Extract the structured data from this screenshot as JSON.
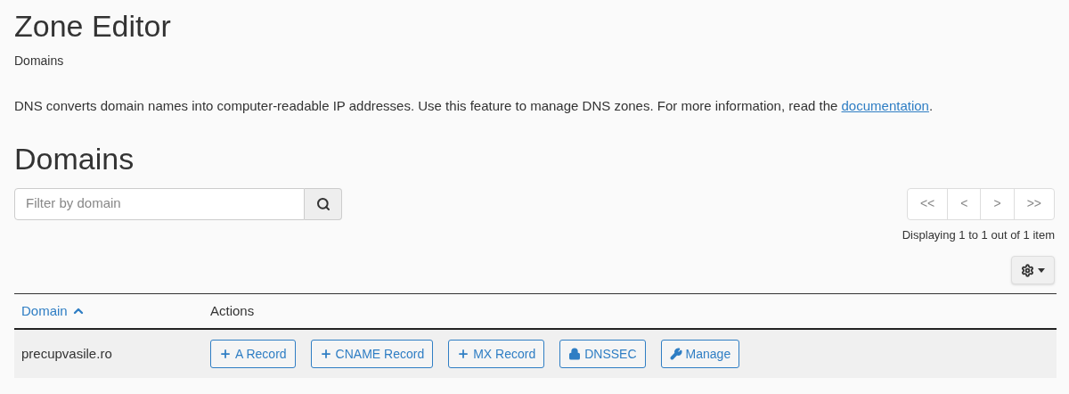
{
  "page": {
    "title": "Zone Editor",
    "breadcrumb": "Domains"
  },
  "intro": {
    "text": "DNS converts domain names into computer-readable IP addresses. Use this feature to manage DNS zones. For more information, read the ",
    "link": "documentation",
    "after": "."
  },
  "section": {
    "title": "Domains"
  },
  "search": {
    "placeholder": "Filter by domain"
  },
  "pagination": {
    "buttons": [
      {
        "label": "<<",
        "disabled": true
      },
      {
        "label": "<",
        "disabled": true
      },
      {
        "label": ">",
        "disabled": true
      },
      {
        "label": ">>",
        "disabled": true
      }
    ],
    "summary": "Displaying 1 to 1 out of 1 item"
  },
  "table": {
    "columns": [
      {
        "label": "Domain",
        "sorted": true
      },
      {
        "label": "Actions",
        "sorted": false
      }
    ],
    "rows": [
      {
        "domain": "precupvasile.ro",
        "actions": [
          {
            "label": "A Record",
            "kind": "add"
          },
          {
            "label": "CNAME Record",
            "kind": "add"
          },
          {
            "label": "MX Record",
            "kind": "add"
          },
          {
            "label": "DNSSEC",
            "kind": "lock"
          },
          {
            "label": "Manage",
            "kind": "wrench"
          }
        ]
      }
    ]
  }
}
